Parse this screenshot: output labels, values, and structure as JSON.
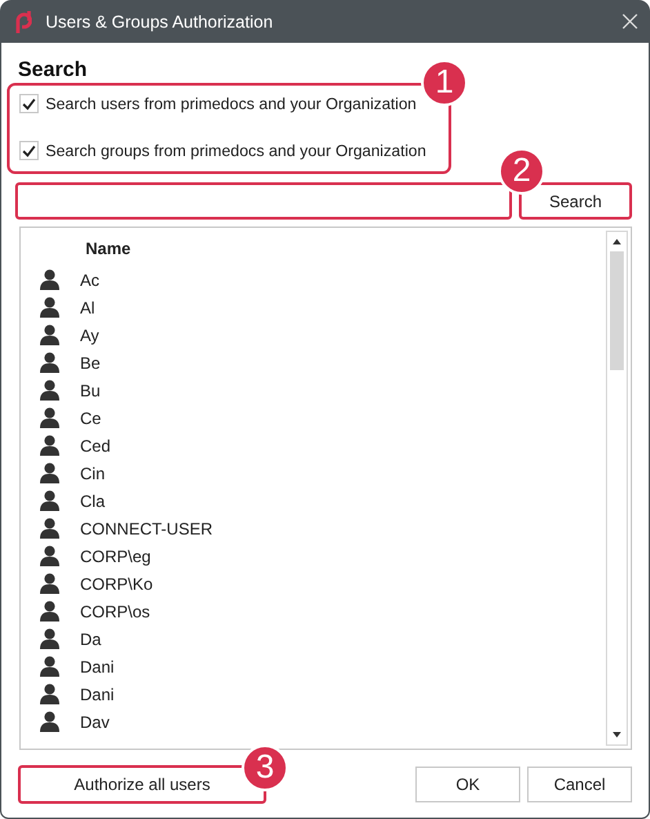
{
  "window": {
    "title": "Users & Groups Authorization"
  },
  "search": {
    "heading": "Search",
    "options": [
      {
        "label": "Search users from primedocs and your Organization",
        "checked": true
      },
      {
        "label": "Search groups from primedocs and your Organization",
        "checked": true
      }
    ],
    "button": "Search"
  },
  "list": {
    "column": "Name",
    "rows": [
      {
        "name": "Ac"
      },
      {
        "name": "Al"
      },
      {
        "name": "Ay"
      },
      {
        "name": "Be"
      },
      {
        "name": "Bu"
      },
      {
        "name": "Ce"
      },
      {
        "name": "Ced"
      },
      {
        "name": "Cin"
      },
      {
        "name": "Cla"
      },
      {
        "name": "CONNECT-USER"
      },
      {
        "name": "CORP\\eg"
      },
      {
        "name": "CORP\\Ko"
      },
      {
        "name": "CORP\\os"
      },
      {
        "name": "Da"
      },
      {
        "name": "Dani"
      },
      {
        "name": "Dani"
      },
      {
        "name": "Dav"
      }
    ]
  },
  "footer": {
    "authorize": "Authorize all users",
    "buttons": [
      "OK",
      "Cancel"
    ]
  },
  "callouts": [
    {
      "number": "1"
    },
    {
      "number": "2"
    },
    {
      "number": "3"
    }
  ]
}
